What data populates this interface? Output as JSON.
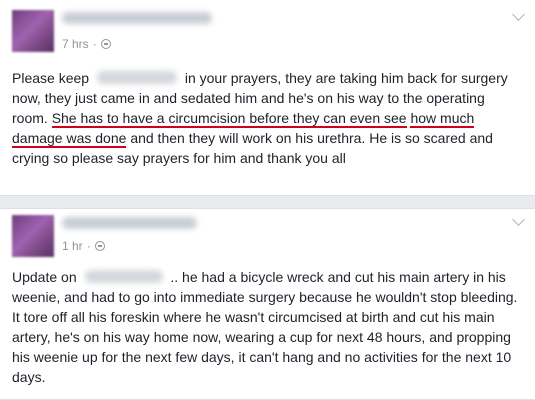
{
  "posts": [
    {
      "time": "7 hrs",
      "separator": "·",
      "text_before_name": "Please keep",
      "text_part_1": "in your prayers, they are taking him back for surgery now, they just came in and sedated him and he's on his way to the operating room.",
      "underlined_part_1": "She has to have a circumcision before they can even see",
      "underlined_part_2": "how much damage was done",
      "text_part_2": "and then they will work on his urethra. He is so scared and crying so please say prayers for him and thank you all"
    },
    {
      "time": "1 hr",
      "separator": "·",
      "text_before_name": "Update on",
      "text_part_1": ".. he had a bicycle wreck and cut his main artery in his weenie, and had to go into immediate surgery because he wouldn't stop bleeding. It tore off all his foreskin where he wasn't circumcised at birth and cut his main artery, he's on his way home now, wearing a cup for next 48 hours, and propping his weenie up for the next few days, it can't hang and no activities for the next 10 days."
    }
  ],
  "colors": {
    "annotation_red": "#d0021b",
    "meta_gray": "#90949c",
    "avatar_purple": "#8e4d9c"
  },
  "icons": [
    "globe-icon",
    "chevron-down-icon"
  ]
}
